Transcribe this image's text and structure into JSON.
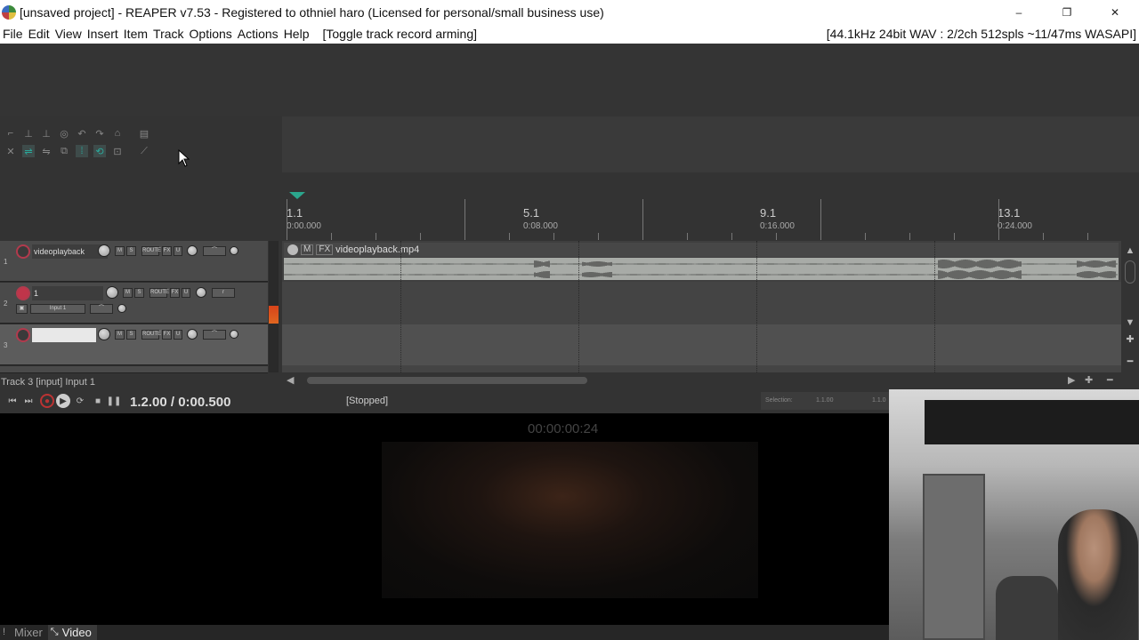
{
  "window": {
    "title": "[unsaved project] - REAPER v7.53 - Registered to othniel haro (Licensed for personal/small business use)",
    "minimize": "–",
    "maximize": "❐",
    "close": "✕"
  },
  "menu": {
    "items": [
      "File",
      "Edit",
      "View",
      "Insert",
      "Item",
      "Track",
      "Options",
      "Actions",
      "Help"
    ],
    "last_action": "[Toggle track record arming]",
    "audio_status": "[44.1kHz 24bit WAV : 2/2ch 512spls ~11/47ms WASAPI]"
  },
  "ruler": {
    "markers": [
      {
        "bar": "1.1",
        "time": "0:00.000"
      },
      {
        "bar": "5.1",
        "time": "0:08.000"
      },
      {
        "bar": "9.1",
        "time": "0:16.000"
      },
      {
        "bar": "13.1",
        "time": "0:24.000"
      }
    ]
  },
  "tracks": [
    {
      "number": "1",
      "name": "videoplayback",
      "armed": false,
      "selected": false,
      "route_label": "ROUTE"
    },
    {
      "number": "2",
      "name": "1",
      "armed": true,
      "selected": false,
      "route_label": "ROUTE",
      "input_label": "Input 1"
    },
    {
      "number": "3",
      "name": "",
      "armed": false,
      "selected": true,
      "route_label": "ROUTE"
    }
  ],
  "media_item": {
    "name": "videoplayback.mp4",
    "tag_m": "M",
    "tag_fx": "FX"
  },
  "status_line": "Track 3 [input] Input 1",
  "transport": {
    "time": "1.2.00 / 0:00.500",
    "state": "[Stopped]",
    "selection_label": "Selection:",
    "selection_start": "1.1.00",
    "selection_end": "1.1.0"
  },
  "video": {
    "timecode": "00:00:00:24"
  },
  "tabs": [
    {
      "label": "Mixer",
      "active": false
    },
    {
      "label": "Video",
      "active": true
    }
  ],
  "colors": {
    "accent": "#2ba68d",
    "record": "#c0354a",
    "meter": "#e0561c"
  }
}
